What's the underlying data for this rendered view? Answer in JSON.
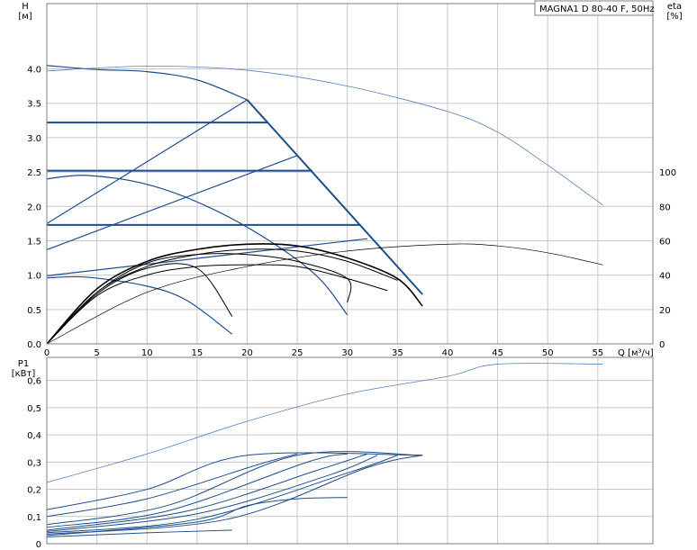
{
  "chart_data": [
    {
      "type": "line",
      "title": "MAGNA1 D 80-40 F, 50Hz",
      "xlabel": "Q [м³/ч]",
      "ylabel": "H\n[м]",
      "y2label": "eta\n[%]",
      "x_ticks": [
        "0",
        "5",
        "10",
        "15",
        "20",
        "25",
        "30",
        "35",
        "40",
        "45",
        "50",
        "55"
      ],
      "y_ticks": [
        "0.0",
        "0.5",
        "1.0",
        "1.5",
        "2.0",
        "2.5",
        "3.0",
        "3.5",
        "4.0"
      ],
      "y2_ticks": [
        "0",
        "20",
        "40",
        "60",
        "80",
        "100"
      ],
      "xlim": [
        0,
        60.5
      ],
      "ylim": [
        0,
        4.95
      ],
      "y2lim": [
        0,
        100
      ],
      "grid": true,
      "series": [
        {
          "role": "head",
          "color": "#1f4e8c",
          "width": 1.2,
          "points": [
            [
              0,
              4.05
            ],
            [
              5,
              3.99
            ],
            [
              10,
              3.96
            ],
            [
              15,
              3.84
            ],
            [
              20,
              3.55
            ]
          ]
        },
        {
          "role": "head",
          "color": "#1f4e8c",
          "width": 1.2,
          "points": [
            [
              0,
              2.4
            ],
            [
              4,
              2.45
            ],
            [
              10,
              2.32
            ],
            [
              16,
              2.0
            ],
            [
              22,
              1.52
            ],
            [
              27,
              0.98
            ],
            [
              30,
              0.42
            ]
          ]
        },
        {
          "role": "head",
          "color": "#1f4e8c",
          "width": 1.2,
          "points": [
            [
              0,
              0.96
            ],
            [
              4,
              0.97
            ],
            [
              10,
              0.84
            ],
            [
              14,
              0.63
            ],
            [
              18.5,
              0.14
            ]
          ]
        },
        {
          "role": "head",
          "color": "#5a7fb8",
          "width": 0.8,
          "points": [
            [
              0,
              3.97
            ],
            [
              10,
              4.04
            ],
            [
              20,
              3.98
            ],
            [
              30,
              3.75
            ],
            [
              40,
              3.38
            ],
            [
              45,
              3.08
            ],
            [
              50,
              2.6
            ],
            [
              55.5,
              2.02
            ]
          ]
        },
        {
          "role": "max-curve",
          "color": "#1f4e8c",
          "width": 2,
          "points": [
            [
              20,
              3.55
            ],
            [
              37.5,
              0.72
            ]
          ]
        },
        {
          "role": "max-curve",
          "color": "#1f4e8c",
          "width": 2,
          "points": [
            [
              0,
              3.22
            ],
            [
              22,
              3.22
            ]
          ]
        },
        {
          "role": "max-curve",
          "color": "#1f4e8c",
          "width": 2,
          "points": [
            [
              0,
              2.52
            ],
            [
              26.5,
              2.52
            ]
          ]
        },
        {
          "role": "max-curve",
          "color": "#1f4e8c",
          "width": 2,
          "points": [
            [
              0,
              1.73
            ],
            [
              31.3,
              1.73
            ]
          ]
        },
        {
          "role": "system",
          "color": "#1f4e8c",
          "width": 1.2,
          "points": [
            [
              0,
              1.75
            ],
            [
              20,
              3.55
            ]
          ]
        },
        {
          "role": "system",
          "color": "#1f4e8c",
          "width": 1.2,
          "points": [
            [
              0,
              1.37
            ],
            [
              25,
              2.74
            ]
          ]
        },
        {
          "role": "system",
          "color": "#1f4e8c",
          "width": 1.2,
          "points": [
            [
              0,
              0.99
            ],
            [
              32,
              1.53
            ]
          ]
        },
        {
          "role": "system",
          "color": "#1f4e8c",
          "width": 1.2,
          "points": [
            [
              25,
              2.74
            ],
            [
              37.5,
              0.72
            ]
          ]
        },
        {
          "role": "efficiency",
          "color": "#000000",
          "width": 1,
          "points": [
            [
              0,
              0
            ],
            [
              5,
              28
            ],
            [
              10,
              40
            ],
            [
              15,
              45
            ],
            [
              20,
              46
            ],
            [
              25,
              45
            ],
            [
              30,
              38
            ],
            [
              34,
              31
            ]
          ]
        },
        {
          "role": "efficiency",
          "color": "#000000",
          "width": 1.6,
          "points": [
            [
              0,
              0
            ],
            [
              5,
              32
            ],
            [
              10,
              48
            ],
            [
              15,
              55
            ],
            [
              20,
              58
            ],
            [
              25,
              57
            ],
            [
              30,
              50
            ],
            [
              35,
              38
            ],
            [
              37.5,
              22
            ]
          ]
        },
        {
          "role": "efficiency",
          "color": "#000000",
          "width": 1,
          "points": [
            [
              0,
              0
            ],
            [
              5,
              30
            ],
            [
              10,
              45
            ],
            [
              15,
              52
            ],
            [
              20,
              55
            ],
            [
              25,
              54
            ],
            [
              30,
              48
            ],
            [
              35,
              37
            ]
          ]
        },
        {
          "role": "efficiency",
          "color": "#000000",
          "width": 1,
          "points": [
            [
              0,
              0
            ],
            [
              5,
              30
            ],
            [
              10,
              47
            ],
            [
              15,
              52
            ],
            [
              20,
              52
            ],
            [
              25,
              48
            ],
            [
              30,
              38
            ],
            [
              30,
              24
            ]
          ]
        },
        {
          "role": "efficiency",
          "color": "#000000",
          "width": 1,
          "points": [
            [
              0,
              0
            ],
            [
              5,
              29
            ],
            [
              10,
              44
            ],
            [
              15,
              44
            ],
            [
              18.5,
              16
            ]
          ]
        },
        {
          "role": "efficiency",
          "color": "#000000",
          "width": 0.7,
          "points": [
            [
              0,
              0
            ],
            [
              10,
              30
            ],
            [
              20,
              45
            ],
            [
              30,
              54
            ],
            [
              40,
              58
            ],
            [
              45,
              57
            ],
            [
              50,
              53
            ],
            [
              55.5,
              46
            ]
          ]
        }
      ]
    },
    {
      "type": "line",
      "ylabel": "P1\n[кВт]",
      "y_ticks": [
        "0",
        "0,1",
        "0,2",
        "0,3",
        "0,4",
        "0,5",
        "0,6"
      ],
      "xlim": [
        0,
        60.5
      ],
      "ylim": [
        0,
        0.685
      ],
      "grid": true,
      "series": [
        {
          "color": "#5a7fb8",
          "width": 0.8,
          "points": [
            [
              0,
              0.225
            ],
            [
              10,
              0.33
            ],
            [
              20,
              0.45
            ],
            [
              30,
              0.55
            ],
            [
              40,
              0.615
            ],
            [
              45,
              0.66
            ],
            [
              55.5,
              0.66
            ]
          ]
        },
        {
          "color": "#1f4e8c",
          "width": 1,
          "points": [
            [
              0,
              0.125
            ],
            [
              10,
              0.2
            ],
            [
              20,
              0.325
            ],
            [
              37.5,
              0.325
            ]
          ]
        },
        {
          "color": "#1f4e8c",
          "width": 1,
          "points": [
            [
              0,
              0.1
            ],
            [
              10,
              0.165
            ],
            [
              21,
              0.29
            ],
            [
              25,
              0.33
            ]
          ]
        },
        {
          "color": "#1f4e8c",
          "width": 1,
          "points": [
            [
              0,
              0.07
            ],
            [
              12,
              0.14
            ],
            [
              25,
              0.325
            ],
            [
              37.5,
              0.325
            ]
          ]
        },
        {
          "color": "#1f4e8c",
          "width": 1,
          "points": [
            [
              0,
              0.06
            ],
            [
              12,
              0.12
            ],
            [
              26,
              0.3
            ],
            [
              30,
              0.33
            ]
          ]
        },
        {
          "color": "#1f4e8c",
          "width": 1,
          "points": [
            [
              0,
              0.05
            ],
            [
              14,
              0.12
            ],
            [
              27,
              0.27
            ],
            [
              32,
              0.33
            ]
          ]
        },
        {
          "color": "#1f4e8c",
          "width": 1,
          "points": [
            [
              0,
              0.045
            ],
            [
              15,
              0.11
            ],
            [
              28,
              0.25
            ],
            [
              33,
              0.325
            ]
          ]
        },
        {
          "color": "#1f4e8c",
          "width": 1,
          "points": [
            [
              0,
              0.04
            ],
            [
              15,
              0.09
            ],
            [
              30,
              0.26
            ],
            [
              35,
              0.325
            ]
          ]
        },
        {
          "color": "#1f4e8c",
          "width": 1,
          "points": [
            [
              0,
              0.035
            ],
            [
              18,
              0.09
            ],
            [
              32,
              0.28
            ],
            [
              37.5,
              0.325
            ]
          ]
        },
        {
          "color": "#1f4e8c",
          "width": 1,
          "points": [
            [
              0,
              0.03
            ],
            [
              15,
              0.08
            ],
            [
              20,
              0.14
            ],
            [
              25,
              0.165
            ],
            [
              30,
              0.17
            ]
          ]
        },
        {
          "color": "#1f4e8c",
          "width": 1,
          "points": [
            [
              0,
              0.025
            ],
            [
              10,
              0.04
            ],
            [
              18.5,
              0.05
            ]
          ]
        }
      ]
    }
  ]
}
